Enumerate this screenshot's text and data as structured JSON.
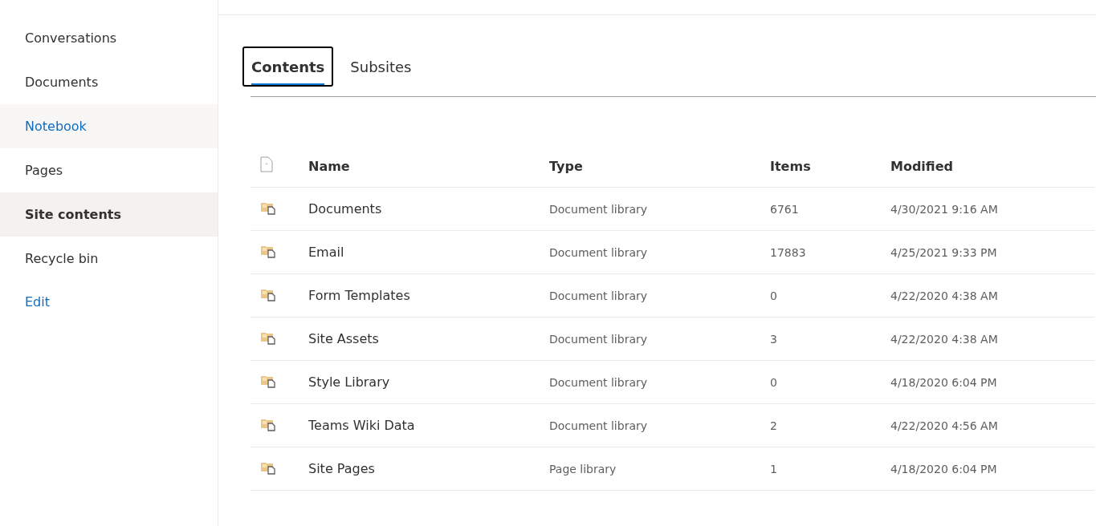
{
  "sidebar": {
    "items": [
      {
        "label": "Conversations",
        "selected": false,
        "hovered": false,
        "kind": "nav"
      },
      {
        "label": "Documents",
        "selected": false,
        "hovered": false,
        "kind": "nav"
      },
      {
        "label": "Notebook",
        "selected": false,
        "hovered": true,
        "kind": "nav"
      },
      {
        "label": "Pages",
        "selected": false,
        "hovered": false,
        "kind": "nav"
      },
      {
        "label": "Site contents",
        "selected": true,
        "hovered": false,
        "kind": "nav"
      },
      {
        "label": "Recycle bin",
        "selected": false,
        "hovered": false,
        "kind": "nav"
      },
      {
        "label": "Edit",
        "selected": false,
        "kind": "link"
      }
    ]
  },
  "tabs": [
    {
      "label": "Contents",
      "selected": true
    },
    {
      "label": "Subsites",
      "selected": false
    }
  ],
  "table": {
    "columns": [
      "Name",
      "Type",
      "Items",
      "Modified"
    ],
    "rows": [
      {
        "name": "Documents",
        "type": "Document library",
        "items": "6761",
        "modified": "4/30/2021 9:16 AM"
      },
      {
        "name": "Email",
        "type": "Document library",
        "items": "17883",
        "modified": "4/25/2021 9:33 PM"
      },
      {
        "name": "Form Templates",
        "type": "Document library",
        "items": "0",
        "modified": "4/22/2020 4:38 AM"
      },
      {
        "name": "Site Assets",
        "type": "Document library",
        "items": "3",
        "modified": "4/22/2020 4:38 AM"
      },
      {
        "name": "Style Library",
        "type": "Document library",
        "items": "0",
        "modified": "4/18/2020 6:04 PM"
      },
      {
        "name": "Teams Wiki Data",
        "type": "Document library",
        "items": "2",
        "modified": "4/22/2020 4:56 AM"
      },
      {
        "name": "Site Pages",
        "type": "Page library",
        "items": "1",
        "modified": "4/18/2020 6:04 PM"
      }
    ]
  }
}
